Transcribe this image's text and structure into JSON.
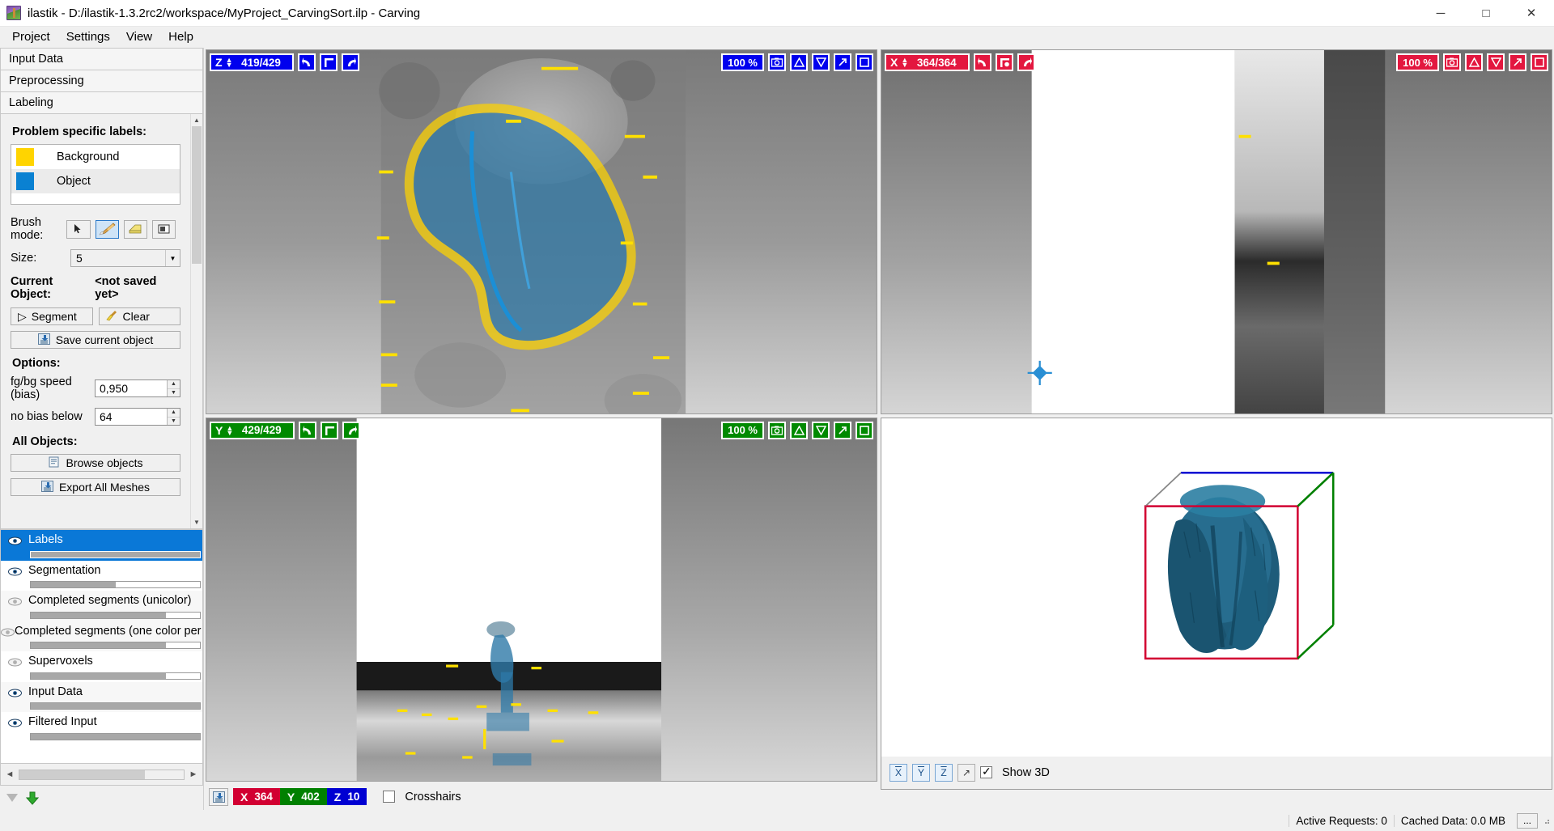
{
  "window": {
    "title": "ilastik - D:/ilastik-1.3.2rc2/workspace/MyProject_CarvingSort.ilp - Carving",
    "minimize": "─",
    "maximize": "□",
    "close": "✕"
  },
  "menubar": {
    "items": [
      {
        "label": "Project"
      },
      {
        "label": "Settings"
      },
      {
        "label": "View"
      },
      {
        "label": "Help"
      }
    ]
  },
  "applets": [
    {
      "label": "Input Data"
    },
    {
      "label": "Preprocessing"
    },
    {
      "label": "Labeling"
    }
  ],
  "drawer": {
    "problem_labels_title": "Problem specific labels:",
    "labels": [
      {
        "name": "Background",
        "color": "#ffd400"
      },
      {
        "name": "Object",
        "color": "#0a81d2"
      }
    ],
    "brush_mode_label": "Brush mode:",
    "brush_tools": [
      {
        "name": "arrow-tool",
        "active": false
      },
      {
        "name": "paint-tool",
        "active": true
      },
      {
        "name": "eraser-tool",
        "active": false
      },
      {
        "name": "rect-tool",
        "active": false
      }
    ],
    "size_label": "Size:",
    "size_value": "5",
    "current_object_label": "Current Object:",
    "current_object_value": "<not saved yet>",
    "segment_label": "Segment",
    "clear_label": "Clear",
    "save_object_label": "Save current object",
    "options_title": "Options:",
    "fgbg_label": "fg/bg speed (bias)",
    "fgbg_value": "0,950",
    "nobias_label": "no bias below",
    "nobias_value": "64",
    "all_objects_title": "All Objects:",
    "browse_objects_label": "Browse objects",
    "export_meshes_label": "Export All Meshes"
  },
  "layers": [
    {
      "name": "Labels",
      "opacity": 100,
      "visible": true,
      "selected": true
    },
    {
      "name": "Segmentation",
      "opacity": 50,
      "visible": true,
      "selected": false
    },
    {
      "name": "Completed segments (unicolor)",
      "opacity": 80,
      "visible": false,
      "selected": false
    },
    {
      "name": "Completed segments (one color per object)",
      "opacity": 80,
      "visible": false,
      "selected": false
    },
    {
      "name": "Supervoxels",
      "opacity": 80,
      "visible": false,
      "selected": false
    },
    {
      "name": "Input Data",
      "opacity": 100,
      "visible": true,
      "selected": false
    },
    {
      "name": "Filtered Input",
      "opacity": 100,
      "visible": true,
      "selected": false
    }
  ],
  "viewers": {
    "z_view": {
      "axis": "Z",
      "slice": "419/429",
      "zoom": "100 %",
      "color": "#0000ee",
      "tools": [
        "undo-arrow",
        "corner-bracket",
        "redo-arrow"
      ],
      "right_tools": [
        "camera-icon",
        "triangle-up-icon",
        "triangle-down-icon",
        "diagonal-arrow-icon",
        "square-icon"
      ]
    },
    "x_view": {
      "axis": "X",
      "slice": "364/364",
      "zoom": "100 %",
      "color": "#e3173f",
      "tools": [
        "undo-arrow",
        "corner-dot-bracket",
        "redo-arrow"
      ],
      "right_tools": [
        "camera-icon",
        "triangle-up-icon",
        "triangle-down-icon",
        "diagonal-arrow-icon",
        "square-icon"
      ]
    },
    "y_view": {
      "axis": "Y",
      "slice": "429/429",
      "zoom": "100 %",
      "color": "#008a00",
      "tools": [
        "undo-arrow",
        "corner-bracket",
        "redo-arrow"
      ],
      "right_tools": [
        "camera-icon",
        "triangle-up-icon",
        "triangle-down-icon",
        "diagonal-arrow-icon",
        "square-icon"
      ]
    }
  },
  "view3d": {
    "axis_buttons": [
      {
        "label": "X",
        "name": "x-axis-button"
      },
      {
        "label": "Y",
        "name": "y-axis-button"
      },
      {
        "label": "Z",
        "name": "z-axis-button"
      }
    ],
    "expand_label": "↗",
    "show3d_label": "Show 3D",
    "show3d_checked": true,
    "mesh_color": "#1e5c7a",
    "box_colors": {
      "x": "#d20032",
      "y": "#008000",
      "z": "#0000d2"
    }
  },
  "coordbar": {
    "x_axis": "X",
    "x_value": "364",
    "y_axis": "Y",
    "y_value": "402",
    "z_axis": "Z",
    "z_value": "10",
    "crosshairs_label": "Crosshairs",
    "crosshairs_checked": false
  },
  "statusbar": {
    "active_requests": "Active Requests: 0",
    "cached_data": "Cached Data: 0.0 MB",
    "more_button": "..."
  }
}
